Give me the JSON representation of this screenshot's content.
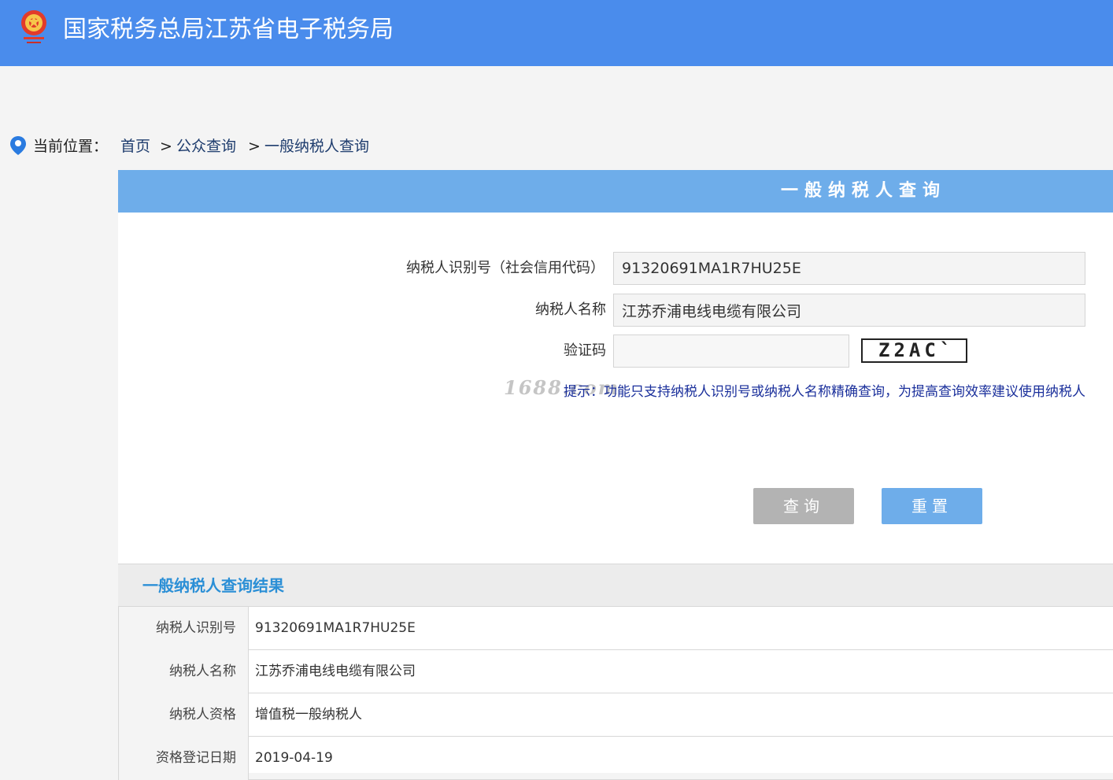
{
  "header": {
    "title": "国家税务总局江苏省电子税务局",
    "background_color": "#4a8cec"
  },
  "breadcrumb": {
    "label": "当前位置：",
    "items": [
      "首页",
      "公众查询",
      "一般纳税人查询"
    ],
    "separator": ">"
  },
  "panel": {
    "title": "一般纳税人查询",
    "header_color": "#6eadea"
  },
  "form": {
    "taxpayer_id_label": "纳税人识别号（社会信用代码）",
    "taxpayer_id_value": "91320691MA1R7HU25E",
    "taxpayer_name_label": "纳税人名称",
    "taxpayer_name_value": "江苏乔浦电线电缆有限公司",
    "captcha_label": "验证码",
    "captcha_value": "",
    "captcha_image_text": "Z2AC`",
    "hint_label": "提示：",
    "hint_text": "功能只支持纳税人识别号或纳税人名称精确查询，为提高查询效率建议使用纳税人",
    "query_button": "查询",
    "reset_button": "重置"
  },
  "watermark": "1688.com",
  "result": {
    "title": "一般纳税人查询结果",
    "rows": [
      {
        "label": "纳税人识别号",
        "value": "91320691MA1R7HU25E"
      },
      {
        "label": "纳税人名称",
        "value": "江苏乔浦电线电缆有限公司"
      },
      {
        "label": "纳税人资格",
        "value": "增值税一般纳税人"
      },
      {
        "label": "资格登记日期",
        "value": "2019-04-19"
      }
    ]
  }
}
